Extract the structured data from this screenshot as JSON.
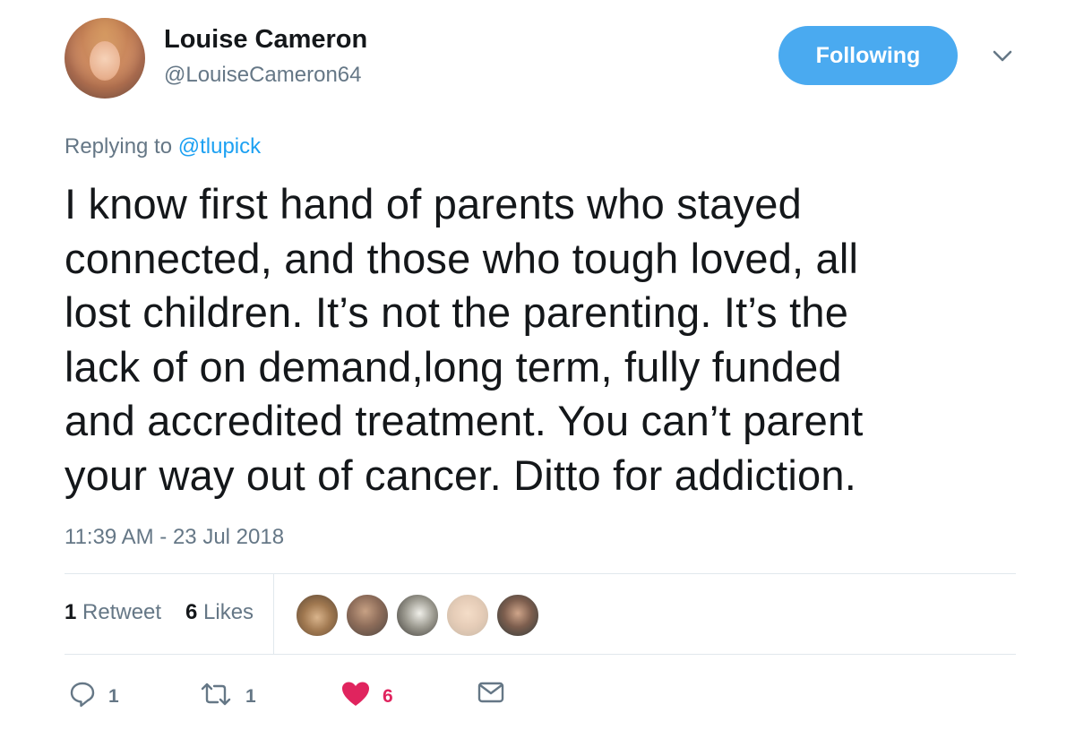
{
  "user": {
    "display_name": "Louise Cameron",
    "handle": "@LouiseCameron64",
    "follow_button": "Following"
  },
  "reply": {
    "prefix": "Replying to",
    "mention": "@tlupick"
  },
  "tweet": {
    "text": "I know first hand of parents who stayed\nconnected, and those who tough loved, all\nlost children. It’s not the parenting. It’s the\nlack of on demand,long term, fully funded\nand accredited treatment. You can’t parent\nyour way out of cancer. Ditto for addiction.",
    "timestamp": "11:39 AM - 23 Jul 2018"
  },
  "stats": {
    "retweet_count": "1",
    "retweet_label": "Retweet",
    "like_count": "6",
    "like_label": "Likes"
  },
  "actions": {
    "reply_count": "1",
    "retweet_count": "1",
    "like_count": "6"
  },
  "colors": {
    "accent": "#1da1f2",
    "follow_button": "#4aaaf0",
    "like_active": "#e0245e",
    "muted": "#657786"
  },
  "icons": [
    "chevron-down-icon",
    "reply-icon",
    "retweet-icon",
    "heart-icon",
    "envelope-icon"
  ]
}
